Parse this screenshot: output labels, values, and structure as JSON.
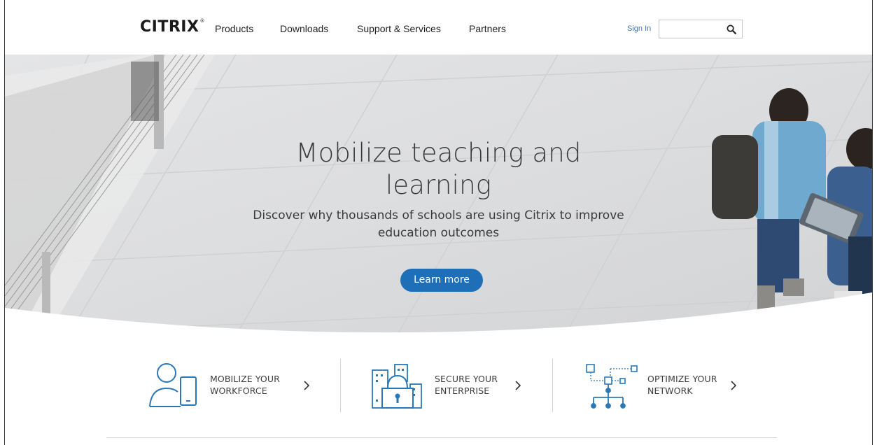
{
  "header": {
    "logo": "CITRIX",
    "nav": [
      "Products",
      "Downloads",
      "Support & Services",
      "Partners"
    ],
    "sign_in": "Sign In",
    "search": {
      "value": "",
      "placeholder": "",
      "icon": "search-icon"
    }
  },
  "hero": {
    "title_line1": "Mobilize teaching and",
    "title_line2": "learning",
    "subtitle_line1": "Discover why thousands of schools are using Citrix to improve",
    "subtitle_line2": "education outcomes",
    "cta": "Learn more"
  },
  "features": [
    {
      "line1": "MOBILIZE YOUR",
      "line2": "WORKFORCE",
      "icon": "user-mobile-icon"
    },
    {
      "line1": "SECURE YOUR",
      "line2": "ENTERPRISE",
      "icon": "buildings-lock-icon"
    },
    {
      "line1": "OPTIMIZE YOUR",
      "line2": "NETWORK",
      "icon": "network-icon"
    }
  ],
  "colors": {
    "accent": "#1f6fb8",
    "icon_blue": "#2a78b8",
    "link": "#4a76a8",
    "text": "#333333"
  }
}
